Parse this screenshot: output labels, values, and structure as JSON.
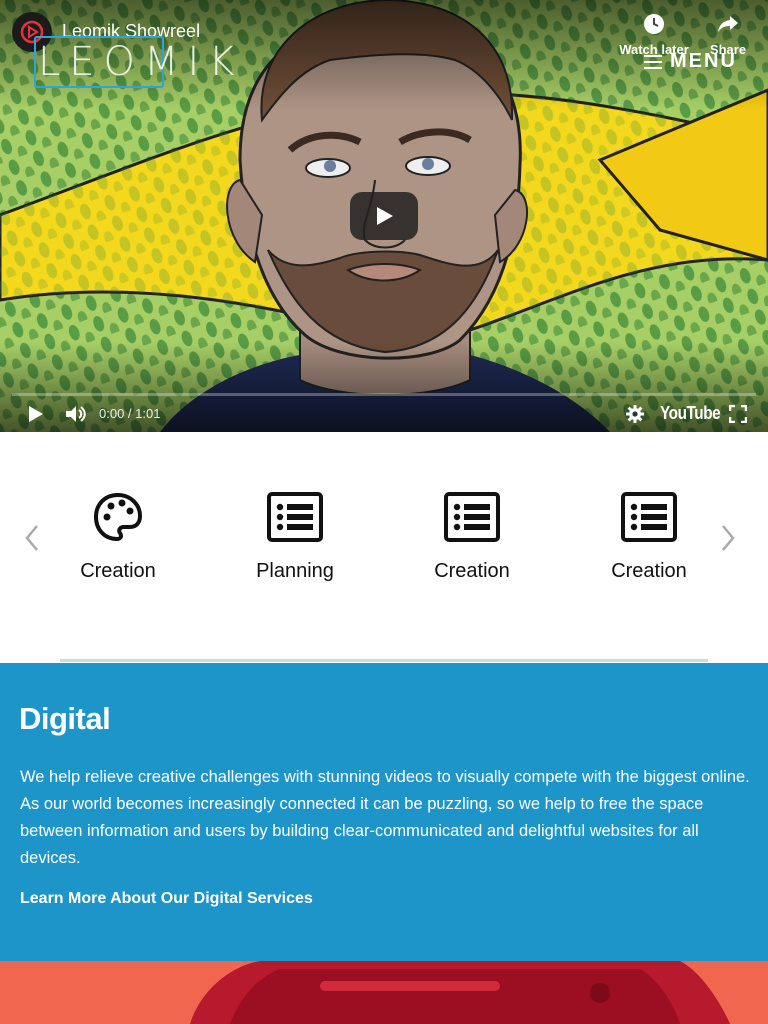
{
  "video": {
    "title": "Leomik Showreel",
    "watch_later_label": "Watch later",
    "share_label": "Share",
    "time": "0:00 / 1:01",
    "progress": 0,
    "player_brand": "YouTube"
  },
  "header": {
    "logo_text": "LEOMIK",
    "menu_label": "MENU"
  },
  "carousel": {
    "items": [
      {
        "label": "Creation",
        "icon": "palette-icon"
      },
      {
        "label": "Planning",
        "icon": "list-icon"
      },
      {
        "label": "Creation",
        "icon": "list-icon"
      },
      {
        "label": "Creation",
        "icon": "list-icon"
      }
    ]
  },
  "digital": {
    "heading": "Digital",
    "body": "We help relieve creative challenges with stunning videos to visually compete with the biggest online. As our world becomes increasingly connected it can be puzzling, so we help to free the space between information and users by building clear-communicated and delightful websites for all devices.",
    "link_label": "Learn More About Our Digital Services"
  },
  "colors": {
    "accent_blue": "#1e95c9",
    "logo_blue": "#2ea4d8",
    "progress_red": "#ff0000",
    "bottom_image_red": "#f0664f"
  }
}
